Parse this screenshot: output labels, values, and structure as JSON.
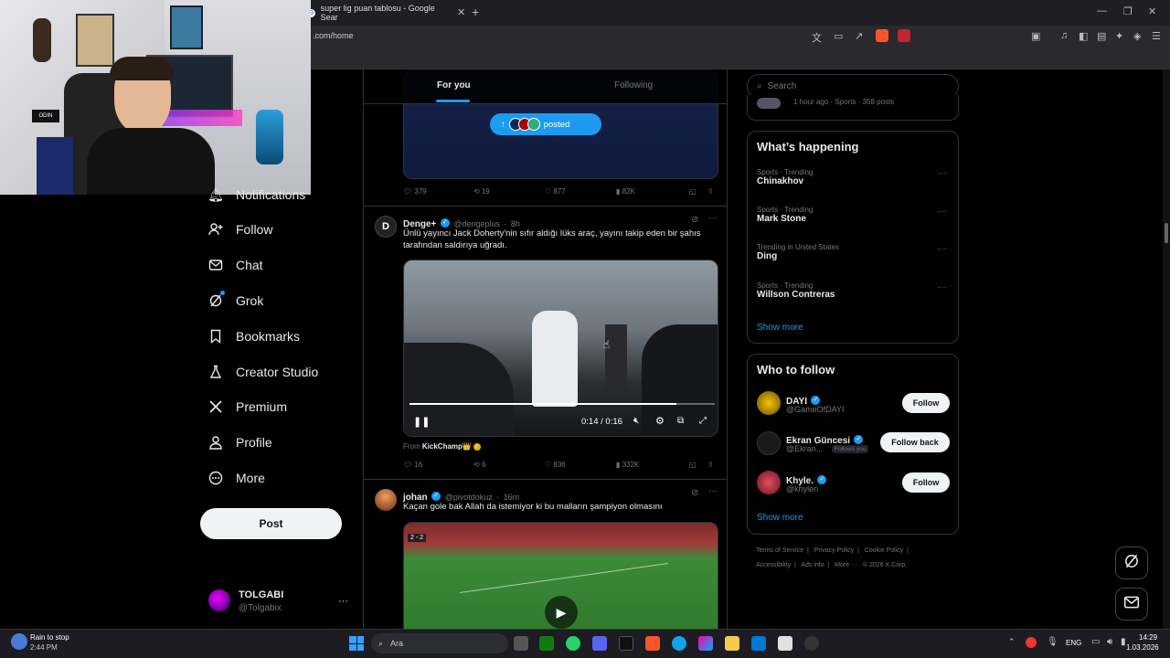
{
  "browser": {
    "tab_title": "super lig puan tablosu - Google Sear",
    "address": ".com/home",
    "window_min": "—",
    "window_max": "❐",
    "window_close": "✕"
  },
  "nav": {
    "items": [
      "Notifications",
      "Follow",
      "Chat",
      "Grok",
      "Bookmarks",
      "Creator Studio",
      "Premium",
      "Profile",
      "More"
    ],
    "post_label": "Post",
    "account_name": "TOLGABI",
    "account_handle": "@Tolgabix",
    "account_more": "···"
  },
  "feed": {
    "tab_for_you": "For you",
    "tab_following": "Following",
    "posted_pill": "posted",
    "post0": {
      "replies": "379",
      "reposts": "19",
      "likes": "877",
      "views": "82K"
    },
    "post1": {
      "name": "Denge+",
      "handle": "@dengeplus",
      "time": "8h",
      "text": "Ünlü yayıncı Jack Doherty'nin sıfır aldığı lüks araç, yayını takip eden bir şahıs tarafından saldırıya uğradı.",
      "video_time": "0:14 / 0:16",
      "from_label": "From",
      "from_name": "KickChamp👑",
      "replies": "16",
      "reposts": "6",
      "likes": "836",
      "views": "332K"
    },
    "post2": {
      "name": "johan",
      "handle": "@pivotdokuz",
      "time": "16m",
      "text": "Kaçan gole bak Allah da istemiyor ki bu malların şampiyon olmasını",
      "score": "2 - 2"
    }
  },
  "right": {
    "search_placeholder": "Search",
    "top_meta": "1 hour ago · Sports · 358 posts",
    "happening_title": "What’s happening",
    "trends": [
      {
        "cat": "Sports · Trending",
        "name": "Chinakhov"
      },
      {
        "cat": "Sports · Trending",
        "name": "Mark Stone"
      },
      {
        "cat": "Trending in United States",
        "name": "Ding"
      },
      {
        "cat": "Sports · Trending",
        "name": "Willson Contreras"
      }
    ],
    "trend_more": "···",
    "show_more": "Show more",
    "wtf_title": "Who to follow",
    "wtf": [
      {
        "name": "DAYI",
        "handle": "@GameOfDAYI",
        "btn": "Follow",
        "follows_you": ""
      },
      {
        "name": "Ekran Güncesi",
        "handle": "@Ekran...",
        "btn": "Follow back",
        "follows_you": "Follows you"
      },
      {
        "name": "Khyle.",
        "handle": "@khyleri",
        "btn": "Follow",
        "follows_you": ""
      }
    ],
    "wtf_show_more": "Show more",
    "footer_line1": [
      "Terms of Service",
      "|",
      "Privacy Policy",
      "|",
      "Cookie Policy",
      "|"
    ],
    "footer_line2": [
      "Accessibility",
      "|",
      "Ads info",
      "|",
      "More ···",
      "© 2026 X Corp."
    ]
  },
  "taskbar": {
    "weather_title": "Rain to stop",
    "weather_time": "2:44 PM",
    "search_label": "Ara",
    "lang": "ENG",
    "clock_time": "14:29",
    "clock_date": "1.03.2026"
  },
  "colors": {
    "accent": "#1d9bf0",
    "bg": "#000000",
    "border": "#2f3336",
    "muted": "#71767b"
  }
}
